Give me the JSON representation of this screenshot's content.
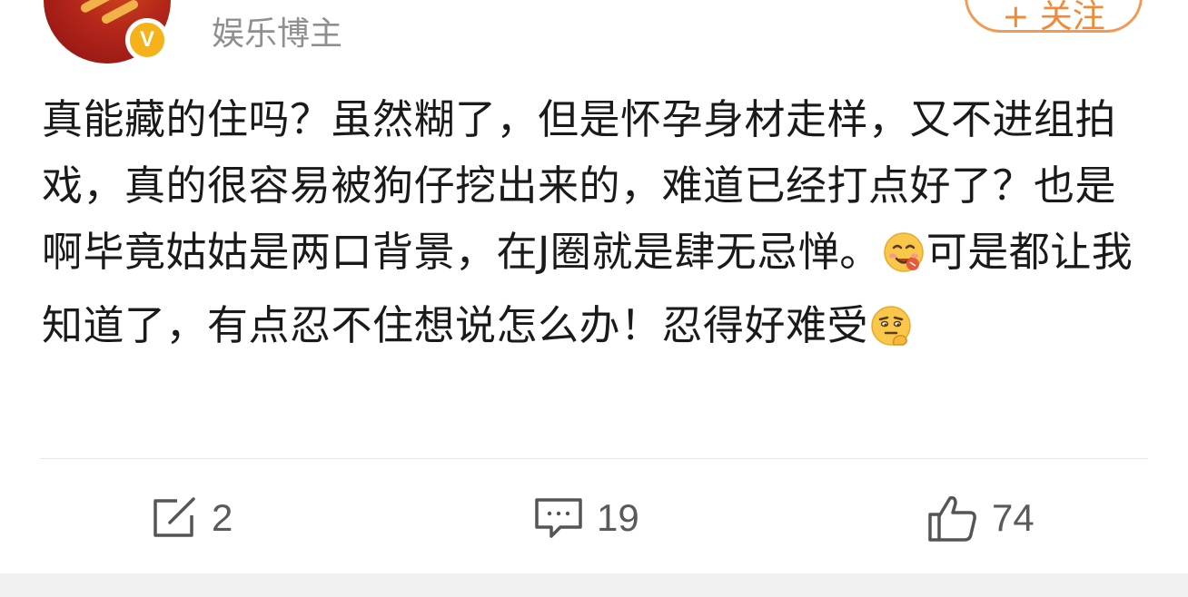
{
  "header": {
    "author_title": "娱乐博主",
    "verified_badge": "V",
    "follow_label": "+ 关注"
  },
  "post": {
    "text_part1": "真能藏的住吗？虽然糊了，但是怀孕身材走样，又不进组拍戏，真的很容易被狗仔挖出来的，难道已经打点好了？也是啊毕竟姑姑是两口背景，在J圈就是肆无忌惮。",
    "emoji1": "yum-emoji",
    "text_part2": "可是都让我知道了，有点忍不住想说怎么办！忍得好难受",
    "emoji2": "thinking-emoji"
  },
  "actions": {
    "repost_count": "2",
    "comment_count": "19",
    "like_count": "74"
  },
  "colors": {
    "accent": "#f28a35",
    "badge": "#f6b21b",
    "muted_text": "#8f8f8f",
    "body_text": "#1a1a1a"
  }
}
